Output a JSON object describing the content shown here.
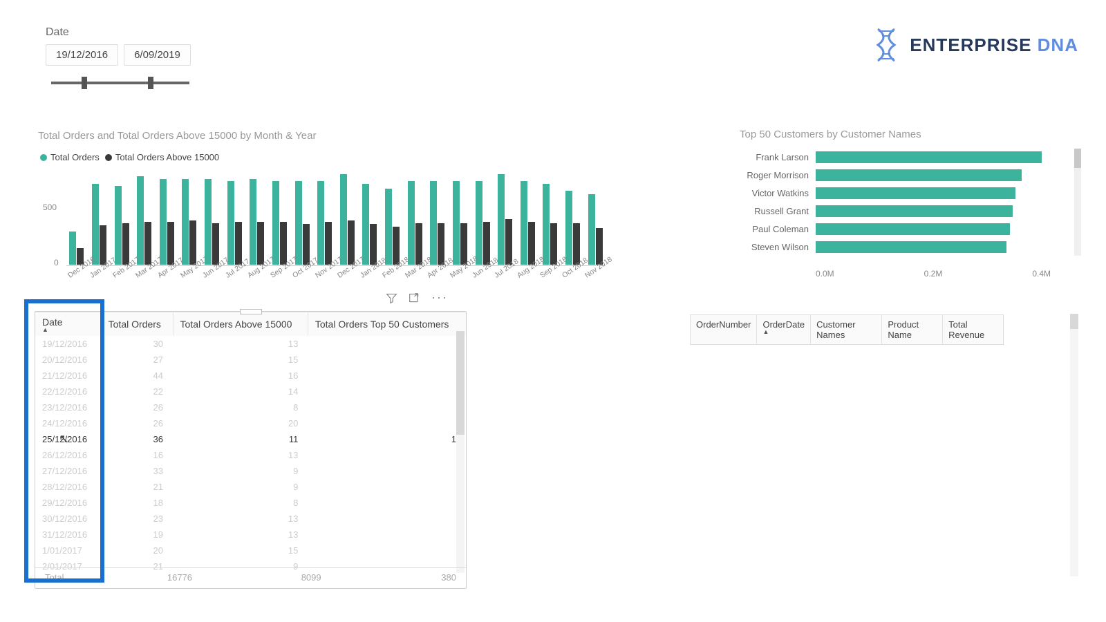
{
  "date_slicer": {
    "label": "Date",
    "start": "19/12/2016",
    "end": "6/09/2019"
  },
  "logo": {
    "part1": "ENTERPRISE",
    "part2": "DNA"
  },
  "bar_chart": {
    "title": "Total Orders and Total Orders Above 15000 by Month & Year",
    "legend1": "Total Orders",
    "legend2": "Total Orders Above 15000",
    "ylabels": [
      "500",
      "0"
    ]
  },
  "hbar": {
    "title": "Top 50 Customers by Customer Names",
    "axis": [
      "0.0M",
      "0.2M",
      "0.4M"
    ]
  },
  "table": {
    "headers": [
      "Date",
      "Total Orders",
      "Total Orders Above 15000",
      "Total Orders Top 50 Customers"
    ],
    "rows": [
      [
        "19/12/2016",
        "30",
        "13",
        ""
      ],
      [
        "20/12/2016",
        "27",
        "15",
        ""
      ],
      [
        "21/12/2016",
        "44",
        "16",
        ""
      ],
      [
        "22/12/2016",
        "22",
        "14",
        ""
      ],
      [
        "23/12/2016",
        "26",
        "8",
        ""
      ],
      [
        "24/12/2016",
        "26",
        "20",
        ""
      ],
      [
        "25/12/2016",
        "36",
        "11",
        "1"
      ],
      [
        "26/12/2016",
        "16",
        "13",
        ""
      ],
      [
        "27/12/2016",
        "33",
        "9",
        ""
      ],
      [
        "28/12/2016",
        "21",
        "9",
        ""
      ],
      [
        "29/12/2016",
        "18",
        "8",
        ""
      ],
      [
        "30/12/2016",
        "23",
        "13",
        ""
      ],
      [
        "31/12/2016",
        "19",
        "13",
        ""
      ],
      [
        "1/01/2017",
        "20",
        "15",
        ""
      ],
      [
        "2/01/2017",
        "21",
        "9",
        ""
      ]
    ],
    "active_row": 6,
    "total": [
      "Total",
      "16776",
      "8099",
      "380"
    ]
  },
  "right_table": {
    "headers": [
      "OrderNumber",
      "OrderDate",
      "Customer Names",
      "Product Name",
      "Total Revenue"
    ]
  },
  "chart_data": {
    "column_chart": {
      "type": "bar",
      "title": "Total Orders and Total Orders Above 15000 by Month & Year",
      "ylabel": "",
      "ylim": [
        0,
        800
      ],
      "categories": [
        "Dec 2016",
        "Jan 2017",
        "Feb 2017",
        "Mar 2017",
        "Apr 2017",
        "May 2017",
        "Jun 2017",
        "Jul 2017",
        "Aug 2017",
        "Sep 2017",
        "Oct 2017",
        "Nov 2017",
        "Dec 2017",
        "Jan 2018",
        "Feb 2018",
        "Mar 2018",
        "Apr 2018",
        "May 2018",
        "Jun 2018",
        "Jul 2018",
        "Aug 2018",
        "Sep 2018",
        "Oct 2018",
        "Nov 2018"
      ],
      "series": [
        {
          "name": "Total Orders",
          "values": [
            280,
            680,
            660,
            740,
            720,
            720,
            720,
            700,
            720,
            700,
            700,
            700,
            760,
            680,
            640,
            700,
            700,
            700,
            700,
            760,
            700,
            680,
            620,
            590
          ]
        },
        {
          "name": "Total Orders Above 15000",
          "values": [
            140,
            330,
            350,
            360,
            360,
            370,
            350,
            360,
            360,
            360,
            340,
            360,
            370,
            340,
            320,
            350,
            350,
            350,
            360,
            380,
            360,
            350,
            350,
            310
          ]
        }
      ]
    },
    "top50_chart": {
      "type": "bar",
      "orientation": "horizontal",
      "title": "Top 50 Customers by Customer Names",
      "xlim": [
        0,
        400000
      ],
      "xlabels": [
        "0.0M",
        "0.2M",
        "0.4M"
      ],
      "categories": [
        "Frank Larson",
        "Roger Morrison",
        "Victor Watkins",
        "Russell Grant",
        "Paul Coleman",
        "Steven Wilson"
      ],
      "values": [
        385000,
        350000,
        340000,
        335000,
        330000,
        325000
      ]
    }
  }
}
